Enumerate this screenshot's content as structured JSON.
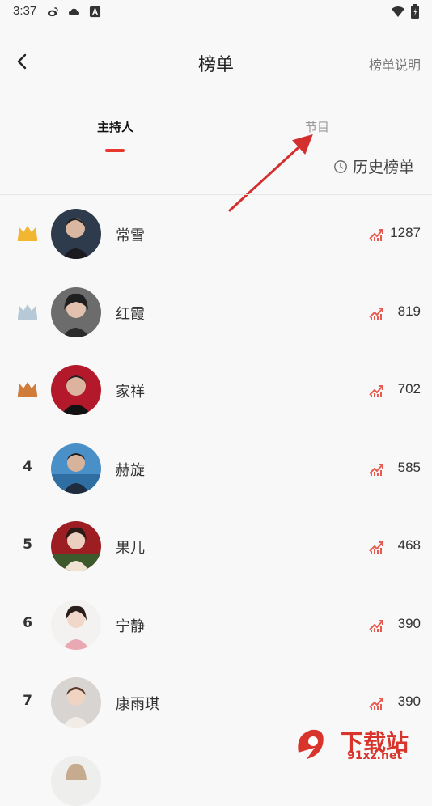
{
  "status_bar": {
    "time": "3:37"
  },
  "header": {
    "title": "榜单",
    "rules_link": "榜单说明"
  },
  "tabs": [
    {
      "label": "主持人",
      "selected": true
    },
    {
      "label": "节目",
      "selected": false
    }
  ],
  "history_button": {
    "label": "历史榜单"
  },
  "colors": {
    "accent": "#e7382f",
    "gold": "#f2b632",
    "silver": "#b7c9d6",
    "bronze": "#d07c3a",
    "trend": "#e85a4f"
  },
  "ranking": [
    {
      "rank": "1",
      "badge": "gold-crown-icon",
      "name": "常雪",
      "score": "1287"
    },
    {
      "rank": "2",
      "badge": "silver-crown-icon",
      "name": "红霞",
      "score": "819"
    },
    {
      "rank": "3",
      "badge": "bronze-crown-icon",
      "name": "家祥",
      "score": "702"
    },
    {
      "rank": "4",
      "badge": "",
      "name": "赫旋",
      "score": "585"
    },
    {
      "rank": "5",
      "badge": "",
      "name": "果儿",
      "score": "468"
    },
    {
      "rank": "6",
      "badge": "",
      "name": "宁静",
      "score": "390"
    },
    {
      "rank": "7",
      "badge": "",
      "name": "康雨琪",
      "score": "390"
    }
  ],
  "watermark": {
    "line1": "下载站",
    "line2": "91xz.net"
  }
}
